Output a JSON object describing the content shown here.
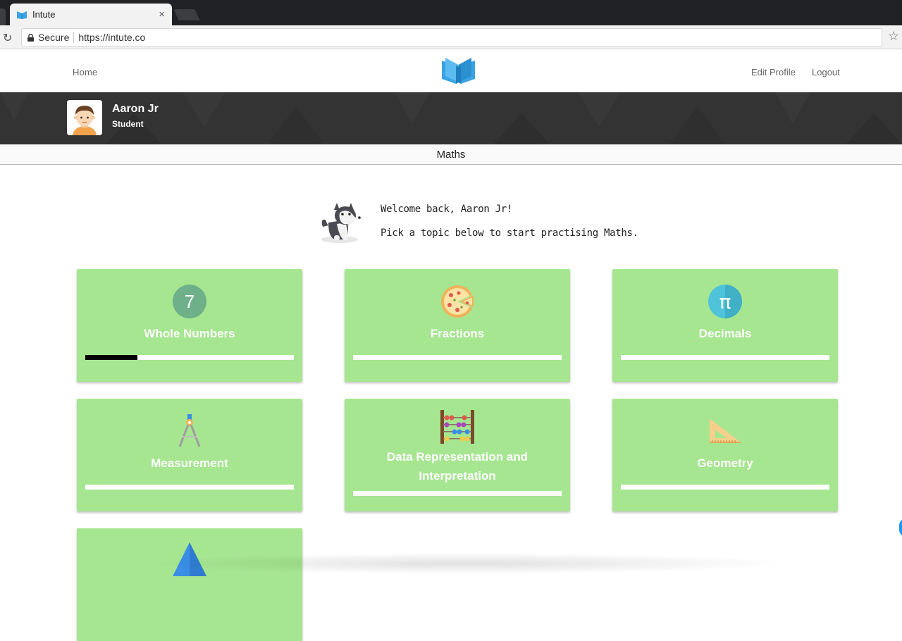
{
  "browser": {
    "tab_title": "Intute",
    "tab_close": "×",
    "secure_label": "Secure",
    "url": "https://intute.co",
    "reload_glyph": "↻",
    "star_glyph": "☆"
  },
  "header": {
    "home_label": "Home",
    "edit_profile_label": "Edit Profile",
    "logout_label": "Logout",
    "logo_icon": "open-book-icon",
    "brand_color": "#3aa3e3"
  },
  "profile": {
    "name": "Aaron Jr",
    "role": "Student",
    "avatar_icon": "boy-avatar-icon"
  },
  "subject": {
    "title": "Maths"
  },
  "welcome": {
    "line1": "Welcome back, Aaron Jr!",
    "line2": "Pick a topic below to start practising Maths.",
    "mascot_icon": "husky-dog-icon"
  },
  "topics": [
    {
      "label": "Whole Numbers",
      "icon": "number-seven-icon",
      "icon_text": "7",
      "progress": 0.25
    },
    {
      "label": "Fractions",
      "icon": "pizza-icon",
      "progress": 0
    },
    {
      "label": "Decimals",
      "icon": "pi-icon",
      "icon_text": "π",
      "progress": 0
    },
    {
      "label": "Measurement",
      "icon": "compass-icon",
      "progress": 0
    },
    {
      "label": "Data Representation and Interpretation",
      "label_line1": "Data Representation and",
      "label_line2": "Interpretation",
      "icon": "abacus-icon",
      "progress": 0
    },
    {
      "label": "Geometry",
      "icon": "set-square-icon",
      "progress": 0
    },
    {
      "label": "",
      "icon": "triangle-icon",
      "progress": 0
    }
  ],
  "colors": {
    "card_bg": "#a6e690",
    "band_bg": "#333333",
    "progress_fill": "#000000"
  }
}
